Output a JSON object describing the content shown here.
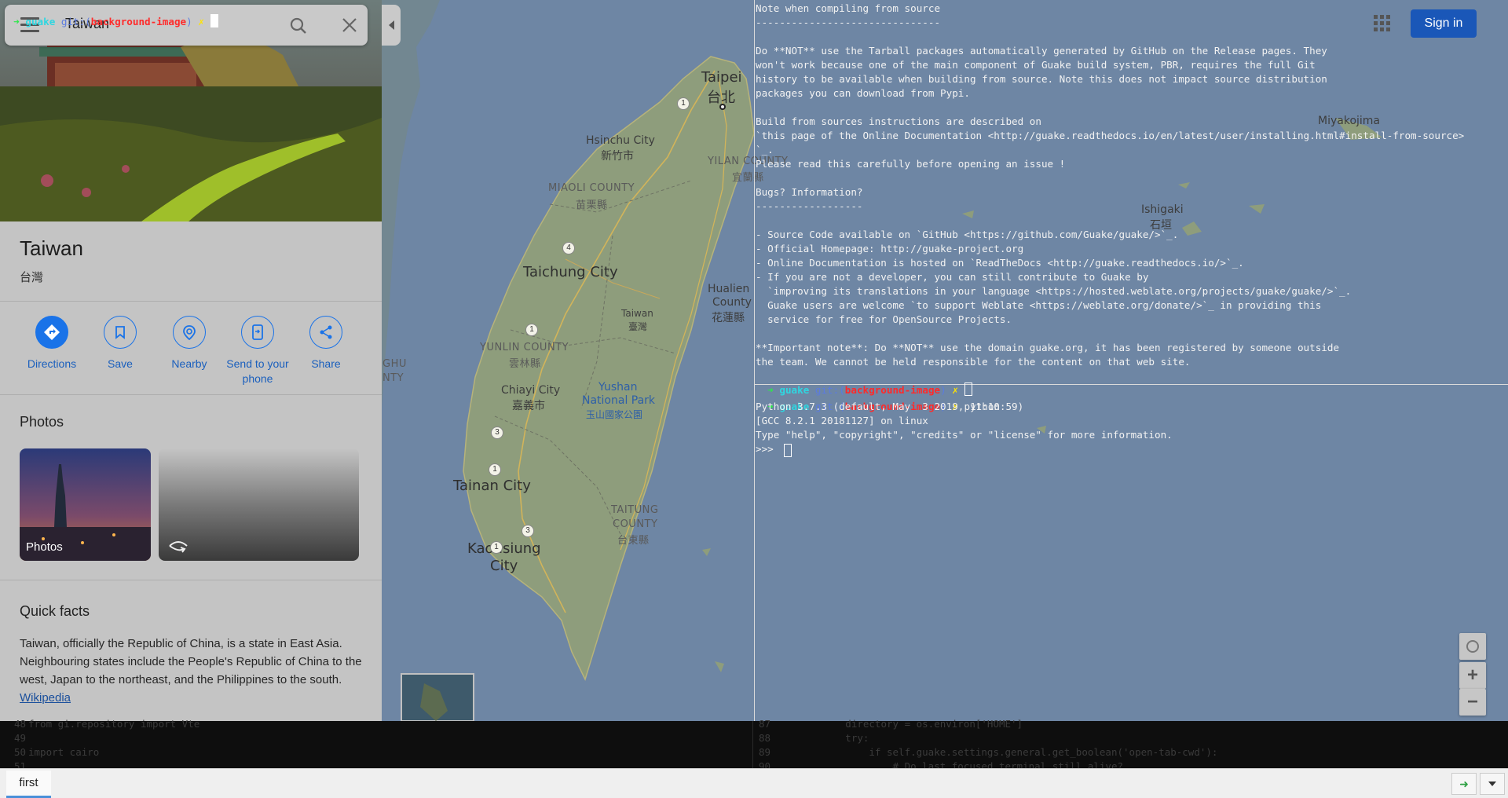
{
  "maps": {
    "search_value": "Taiwan",
    "place_title": "Taiwan",
    "place_subtitle": "台灣",
    "actions": [
      {
        "label": "Directions",
        "icon": "directions-icon"
      },
      {
        "label": "Save",
        "icon": "bookmark-icon"
      },
      {
        "label": "Nearby",
        "icon": "nearby-icon"
      },
      {
        "label": "Send to your phone",
        "icon": "send-to-phone-icon"
      },
      {
        "label": "Share",
        "icon": "share-icon"
      }
    ],
    "photos_heading": "Photos",
    "photo_caption": "Photos",
    "quick_facts_heading": "Quick facts",
    "quick_facts_text": "Taiwan, officially the Republic of China, is a state in East Asia. Neighbouring states include the People's Republic of China to the west, Japan to the northeast, and the Philippines to the south.",
    "quick_facts_link": "Wikipedia",
    "sign_in": "Sign in",
    "zoom_in": "+",
    "zoom_out": "−",
    "map_labels": {
      "taipei": "Taipei",
      "taipei_zh": "台北",
      "hsinchu": "Hsinchu City",
      "hsinchu_zh": "新竹市",
      "yilan": "YILAN COUNTY",
      "yilan_zh": "宜蘭縣",
      "miaoli": "MIAOLI COUNTY",
      "miaoli_zh": "苗栗縣",
      "taichung": "Taichung City",
      "hualien1": "Hualien",
      "hualien2": "County",
      "hualien_zh": "花蓮縣",
      "taiwan": "Taiwan",
      "taiwan_zh": "臺灣",
      "yunlin": "YUNLIN COUNTY",
      "yunlin_zh": "雲林縣",
      "chiayi": "Chiayi City",
      "chiayi_zh": "嘉義市",
      "yushan1": "Yushan",
      "yushan2": "National Park",
      "yushan_zh": "玉山國家公園",
      "tainan": "Tainan City",
      "taitung1": "TAITUNG",
      "taitung2": "COUNTY",
      "taitung_zh": "台東縣",
      "kaohsiung1": "Kaohsiung",
      "kaohsiung2": "City",
      "ghu1": "GHU",
      "ghu2": "NTY",
      "miyakojima": "Miyakojima",
      "ishigaki": "Ishigaki",
      "ishigaki_zh": "石垣",
      "routes": [
        "1",
        "4",
        "1",
        "3",
        "1",
        "1",
        "3"
      ]
    }
  },
  "terminal": {
    "top_prompt": {
      "arrow": "➜",
      "dir": "guake",
      "git": "git:(",
      "branch": "background-image",
      "close": ")",
      "mark": "✗"
    },
    "readme_lines": [
      "Note when compiling from source",
      "-------------------------------",
      "",
      "Do **NOT** use the Tarball packages automatically generated by GitHub on the Release pages. They",
      "won't work because one of the main component of Guake build system, PBR, requires the full Git",
      "history to be available when building from source. Note this does not impact source distribution",
      "packages you can download from Pypi.",
      "",
      "Build from sources instructions are described on",
      "`this page of the Online Documentation <http://guake.readthedocs.io/en/latest/user/installing.html#install-from-source>",
      "`_.",
      "Please read this carefully before opening an issue !",
      "",
      "Bugs? Information?",
      "------------------",
      "",
      "- Source Code available on `GitHub <https://github.com/Guake/guake/>`_.",
      "- Official Homepage: http://guake-project.org",
      "- Online Documentation is hosted on `ReadTheDocs <http://guake.readthedocs.io/>`_.",
      "- If you are not a developer, you can still contribute to Guake by",
      "  `improving its translations in your language <https://hosted.weblate.org/projects/guake/guake/>`_.",
      "  Guake users are welcome `to support Weblate <https://weblate.org/donate/>`_ in providing this",
      "  service for free for OpenSource Projects.",
      "",
      "**Important note**: Do **NOT** use the domain guake.org, it has been registered by someone outside",
      "the team. We cannot be held responsible for the content on that web site."
    ],
    "pane1_prompt": {
      "dir": "guake",
      "git": "git:(",
      "branch": "background-image",
      "close": ")",
      "mark": "✗"
    },
    "pane2_prompt": {
      "dir": "guake",
      "git": "git:(",
      "branch": "background-image",
      "close": ")",
      "mark": "✗",
      "cmd": "python"
    },
    "python_lines": [
      "Python 3.7.3 (default, May  3 2019, 11:10:59)",
      "[GCC 8.2.1 20181127] on linux",
      "Type \"help\", \"copyright\", \"credits\" or \"license\" for more information.",
      ">>> "
    ]
  },
  "editor": {
    "left_lines": [
      {
        "num": "48",
        "code": "from gi.repository import Vte"
      },
      {
        "num": "49",
        "code": ""
      },
      {
        "num": "50",
        "code": "import cairo"
      },
      {
        "num": "51",
        "code": ""
      }
    ],
    "right_lines": [
      {
        "num": "87",
        "code": "            directory = os.environ['HOME']"
      },
      {
        "num": "88",
        "code": "            try:"
      },
      {
        "num": "89",
        "code": "                if self.guake.settings.general.get_boolean('open-tab-cwd'):"
      },
      {
        "num": "90",
        "code": "                    # Do last focused terminal still alive?"
      }
    ]
  },
  "tabs": {
    "items": [
      "first"
    ]
  }
}
